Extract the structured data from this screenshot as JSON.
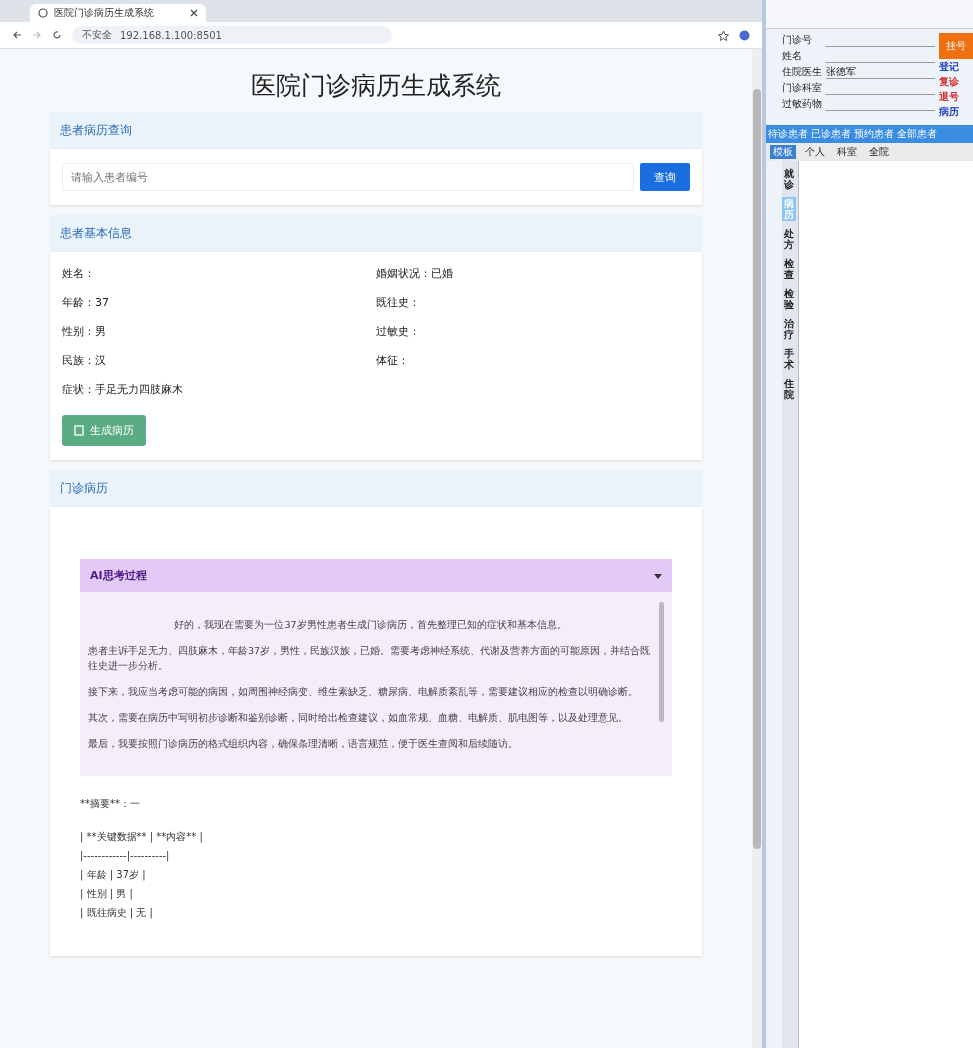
{
  "browser": {
    "tab_title": "医院门诊病历生成系统",
    "security": "不安全",
    "url": "192.168.1.100:8501"
  },
  "page_title": "医院门诊病历生成系统",
  "query": {
    "heading": "患者病历查询",
    "placeholder": "请输入患者编号",
    "button": "查询"
  },
  "patient": {
    "heading": "患者基本信息",
    "fields": [
      {
        "label": "姓名："
      },
      {
        "label": "婚姻状况：",
        "value": "已婚"
      },
      {
        "label": "年龄：",
        "value": "37"
      },
      {
        "label": "既往史："
      },
      {
        "label": "性别：",
        "value": "男"
      },
      {
        "label": "过敏史："
      },
      {
        "label": "民族：",
        "value": "汉"
      },
      {
        "label": "体征："
      },
      {
        "label": "症状：",
        "value": "手足无力四肢麻木"
      }
    ],
    "button": "生成病历"
  },
  "record": {
    "heading": "门诊病历",
    "thinking": {
      "title": "AI思考过程",
      "expanded": true,
      "paragraphs": [
        "好的，我现在需要为一位37岁男性患者生成门诊病历，首先整理已知的症状和基本信息。",
        "患者主诉手足无力、四肢麻木，年龄37岁，男性，民族汉族，已婚。需要考虑神经系统、代谢及营养方面的可能原因，并结合既往史进一步分析。",
        "接下来，我应当考虑可能的病因，如周围神经病变、维生素缺乏、糖尿病、电解质紊乱等，需要建议相应的检查以明确诊断。",
        "其次，需要在病历中写明初步诊断和鉴别诊断，同时给出检查建议，如血常规、血糖、电解质、肌电图等，以及处理意见。",
        "最后，我要按照门诊病历的格式组织内容，确保条理清晰，语言规范，便于医生查阅和后续随访。"
      ]
    },
    "output_lines": [
      "**摘要**：一",
      "| **关键数据** | **内容** |",
      "|------------|----------|",
      "| 年龄 | 37岁 |",
      "| 性别 | 男 |",
      "| 既往病史 | 无 |"
    ]
  },
  "side_app": {
    "fields": [
      {
        "label": "门诊号"
      },
      {
        "label": "姓名"
      },
      {
        "label": "住院医生",
        "value": "张德军"
      },
      {
        "label": "门诊科室"
      },
      {
        "label": "过敏药物"
      }
    ],
    "action_button": "挂号",
    "links": [
      {
        "label": "登记",
        "color": "#2040c0"
      },
      {
        "label": "复诊",
        "color": "#d03030"
      },
      {
        "label": "退号",
        "color": "#d03030"
      },
      {
        "label": "病历",
        "color": "#2040c0"
      }
    ],
    "toolbar": [
      "待诊患者",
      "已诊患者",
      "预约患者",
      "全部患者"
    ],
    "tabs": [
      {
        "label": "模板",
        "selected": true
      },
      {
        "label": "个人",
        "selected": false
      },
      {
        "label": "科室",
        "selected": false
      },
      {
        "label": "全院",
        "selected": false
      }
    ],
    "vertical_tabs": [
      {
        "label": "就诊",
        "selected": false
      },
      {
        "label": "病历",
        "selected": true
      },
      {
        "label": "处方",
        "selected": false
      },
      {
        "label": "检查",
        "selected": false
      },
      {
        "label": "检验",
        "selected": false
      },
      {
        "label": "治疗",
        "selected": false
      },
      {
        "label": "手术",
        "selected": false
      },
      {
        "label": "住院",
        "selected": false
      }
    ]
  }
}
